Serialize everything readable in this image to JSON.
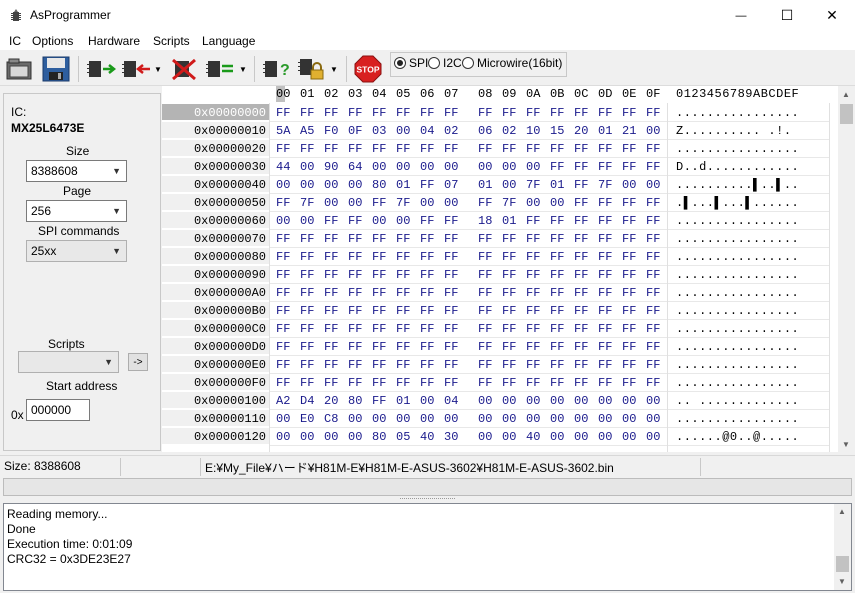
{
  "window": {
    "title": "AsProgrammer",
    "minimize_glyph": "—",
    "maximize_glyph": "☐",
    "close_glyph": "✕"
  },
  "menu": [
    "IC",
    "Options",
    "Hardware",
    "Scripts",
    "Language"
  ],
  "toolbar": {
    "buttons": [
      "open-file-icon",
      "save-file-icon",
      "read-chip-icon",
      "write-chip-icon",
      "erase-chip-icon",
      "verify-chip-icon",
      "ic-info-icon",
      "lock-icon",
      "stop-icon"
    ],
    "stop_label": "STOP",
    "protocols": [
      {
        "label": "SPI",
        "selected": true
      },
      {
        "label": "I2C",
        "selected": false
      },
      {
        "label": "Microwire(16bit)",
        "selected": false
      }
    ]
  },
  "left_panel": {
    "ic_label": "IC:",
    "ic_name": "MX25L6473E",
    "size_label": "Size",
    "size_value": "8388608",
    "page_label": "Page",
    "page_value": "256",
    "spi_label": "SPI commands",
    "spi_value": "25xx",
    "scripts_label": "Scripts",
    "scripts_value": "",
    "run_button": "->",
    "start_label": "Start address",
    "hex_prefix": "0x",
    "start_value": "000000"
  },
  "hex": {
    "columns": [
      "00",
      "01",
      "02",
      "03",
      "04",
      "05",
      "06",
      "07",
      "08",
      "09",
      "0A",
      "0B",
      "0C",
      "0D",
      "0E",
      "0F"
    ],
    "ascii_header": "0123456789ABCDEF",
    "rows": [
      {
        "addr": "0x00000000",
        "bytes": "FF FF FF FF FF FF FF FF FF FF FF FF FF FF FF FF",
        "ascii": "................"
      },
      {
        "addr": "0x00000010",
        "bytes": "5A A5 F0 0F 03 00 04 02 06 02 10 15 20 01 21 00",
        "ascii": "Z.......... .!."
      },
      {
        "addr": "0x00000020",
        "bytes": "FF FF FF FF FF FF FF FF FF FF FF FF FF FF FF FF",
        "ascii": "................"
      },
      {
        "addr": "0x00000030",
        "bytes": "44 00 90 64 00 00 00 00 00 00 00 FF FF FF FF FF",
        "ascii": "D..d............"
      },
      {
        "addr": "0x00000040",
        "bytes": "00 00 00 00 80 01 FF 07 01 00 7F 01 FF 7F 00 00",
        "ascii": "..........▌..▌.."
      },
      {
        "addr": "0x00000050",
        "bytes": "FF 7F 00 00 FF 7F 00 00 FF 7F 00 00 FF FF FF FF",
        "ascii": ".▌...▌...▌......"
      },
      {
        "addr": "0x00000060",
        "bytes": "00 00 FF FF 00 00 FF FF 18 01 FF FF FF FF FF FF",
        "ascii": "................"
      },
      {
        "addr": "0x00000070",
        "bytes": "FF FF FF FF FF FF FF FF FF FF FF FF FF FF FF FF",
        "ascii": "................"
      },
      {
        "addr": "0x00000080",
        "bytes": "FF FF FF FF FF FF FF FF FF FF FF FF FF FF FF FF",
        "ascii": "................"
      },
      {
        "addr": "0x00000090",
        "bytes": "FF FF FF FF FF FF FF FF FF FF FF FF FF FF FF FF",
        "ascii": "................"
      },
      {
        "addr": "0x000000A0",
        "bytes": "FF FF FF FF FF FF FF FF FF FF FF FF FF FF FF FF",
        "ascii": "................"
      },
      {
        "addr": "0x000000B0",
        "bytes": "FF FF FF FF FF FF FF FF FF FF FF FF FF FF FF FF",
        "ascii": "................"
      },
      {
        "addr": "0x000000C0",
        "bytes": "FF FF FF FF FF FF FF FF FF FF FF FF FF FF FF FF",
        "ascii": "................"
      },
      {
        "addr": "0x000000D0",
        "bytes": "FF FF FF FF FF FF FF FF FF FF FF FF FF FF FF FF",
        "ascii": "................"
      },
      {
        "addr": "0x000000E0",
        "bytes": "FF FF FF FF FF FF FF FF FF FF FF FF FF FF FF FF",
        "ascii": "................"
      },
      {
        "addr": "0x000000F0",
        "bytes": "FF FF FF FF FF FF FF FF FF FF FF FF FF FF FF FF",
        "ascii": "................"
      },
      {
        "addr": "0x00000100",
        "bytes": "A2 D4 20 80 FF 01 00 04 00 00 00 00 00 00 00 00",
        "ascii": ".. ............."
      },
      {
        "addr": "0x00000110",
        "bytes": "00 E0 C8 00 00 00 00 00 00 00 00 00 00 00 00 00",
        "ascii": "................"
      },
      {
        "addr": "0x00000120",
        "bytes": "00 00 00 00 80 05 40 30 00 00 40 00 00 00 00 00",
        "ascii": "......@0..@....."
      }
    ]
  },
  "status": {
    "size_text": "Size: 8388608",
    "file_path": "E:¥My_File¥ハード¥H81M-E¥H81M-E-ASUS-3602¥H81M-E-ASUS-3602.bin"
  },
  "log": [
    "Reading memory...",
    "Done",
    "Execution time: 0:01:09",
    "CRC32 = 0x3DE23E27"
  ]
}
